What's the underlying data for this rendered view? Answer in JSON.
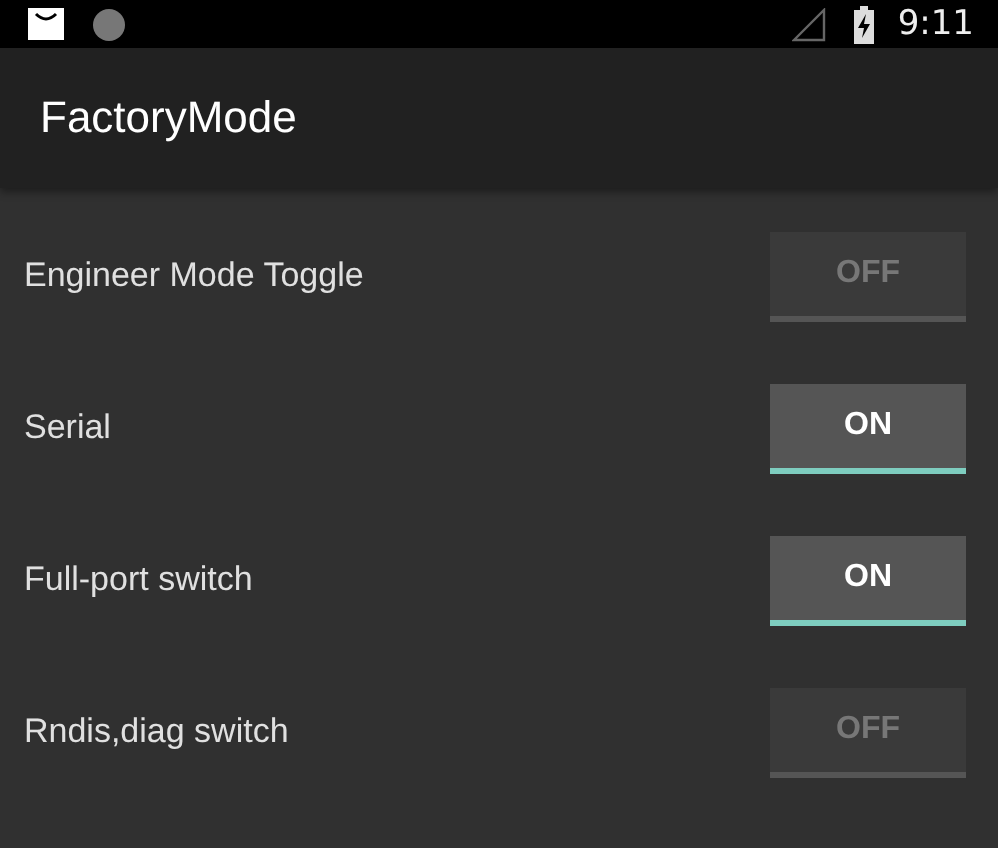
{
  "status_bar": {
    "time": "9:11"
  },
  "app_bar": {
    "title": "FactoryMode"
  },
  "settings": [
    {
      "label": "Engineer Mode Toggle",
      "toggle": "OFF",
      "on": false
    },
    {
      "label": "Serial",
      "toggle": "ON",
      "on": true
    },
    {
      "label": "Full-port switch",
      "toggle": "ON",
      "on": true
    },
    {
      "label": "Rndis,diag switch",
      "toggle": "OFF",
      "on": false
    }
  ]
}
